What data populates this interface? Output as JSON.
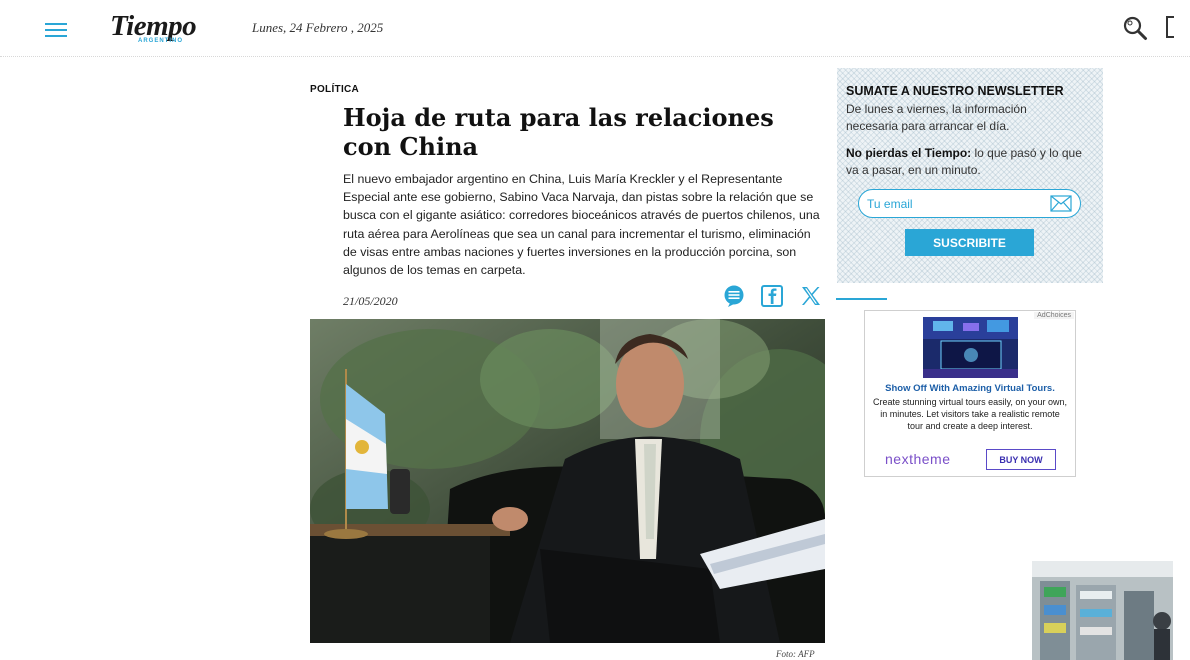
{
  "header": {
    "logo_text": "Tiempo",
    "logo_subtext": "ARGENTINO",
    "date": "Lunes, 24 Febrero , 2025"
  },
  "article": {
    "section": "POLÍTICA",
    "headline": "Hoja de ruta para las relaciones con China",
    "lede": "El nuevo embajador argentino en China, Luis María Kreckler y el Representante Especial ante ese gobierno, Sabino Vaca Narvaja, dan pistas sobre la relación que se busca con el gigante asiático: corredores bioceánicos através de puertos chilenos, una ruta aérea para Aerolíneas que sea un canal para incrementar el turismo, eliminación de visas entre ambas naciones y fuertes inversiones en la producción porcina, son algunos de los temas en carpeta.",
    "date": "21/05/2020",
    "photo_credit": "Foto: AFP"
  },
  "share": {
    "icons": [
      "comment-icon",
      "facebook-icon",
      "x-icon"
    ]
  },
  "newsletter": {
    "title": "SUMATE A NUESTRO NEWSLETTER",
    "description": "De lunes a viernes, la información necesaria para arrancar el día.",
    "note_bold": "No pierdas el Tiempo:",
    "note_text": " lo que pasó y lo que va a pasar, en un minuto.",
    "email_placeholder": "Tu email",
    "button_label": "SUSCRIBITE"
  },
  "ad": {
    "choices_label": "AdChoices",
    "headline": "Show Off With Amazing Virtual Tours.",
    "body": "Create stunning virtual tours easily, on your own, in minutes. Let visitors take a realistic remote tour and create a deep interest.",
    "brand": "nextheme",
    "button_label": "BUY NOW"
  },
  "colors": {
    "accent": "#2aa6d6",
    "text": "#111111",
    "ad_link": "#1d5fa8",
    "ad_brand": "#7a4fc8"
  }
}
